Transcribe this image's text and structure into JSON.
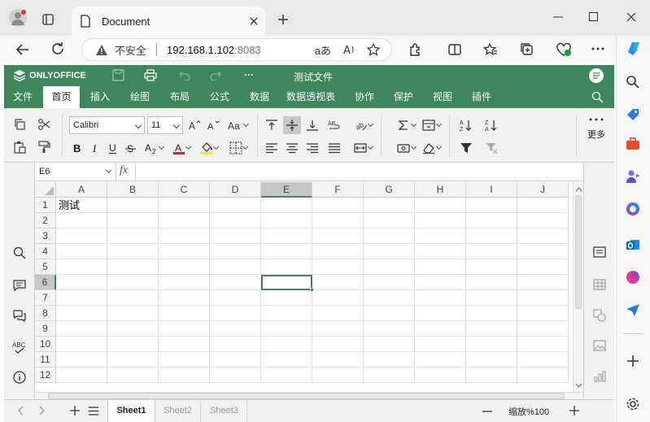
{
  "browser": {
    "tab_title": "Document",
    "security_label": "不安全",
    "url_host": "192.168.1.102",
    "url_port": ":8083"
  },
  "app": {
    "brand": "ONLYOFFICE",
    "doc_title": "测试文件",
    "more_label": "···",
    "accent": "#40865c",
    "menu": [
      "文件",
      "首页",
      "插入",
      "绘图",
      "布局",
      "公式",
      "数据",
      "数据透视表",
      "协作",
      "保护",
      "视图",
      "插件"
    ],
    "active_menu": "首页"
  },
  "toolbar": {
    "font_name": "Calibri",
    "font_size": "11",
    "more_label": "更多"
  },
  "formula": {
    "cell_ref": "E6",
    "fx_label": "fx",
    "value": ""
  },
  "grid": {
    "columns": [
      "A",
      "B",
      "C",
      "D",
      "E",
      "F",
      "G",
      "H",
      "I",
      "J"
    ],
    "rows": [
      "1",
      "2",
      "3",
      "4",
      "5",
      "6",
      "7",
      "8",
      "9",
      "10",
      "11",
      "12"
    ],
    "active_column": "E",
    "active_row": "6",
    "cells": {
      "A1": "测试"
    }
  },
  "sheets": {
    "tabs": [
      "Sheet1",
      "Sheet2",
      "Sheet3"
    ],
    "active": "Sheet1",
    "zoom_label": "缩放%100"
  }
}
